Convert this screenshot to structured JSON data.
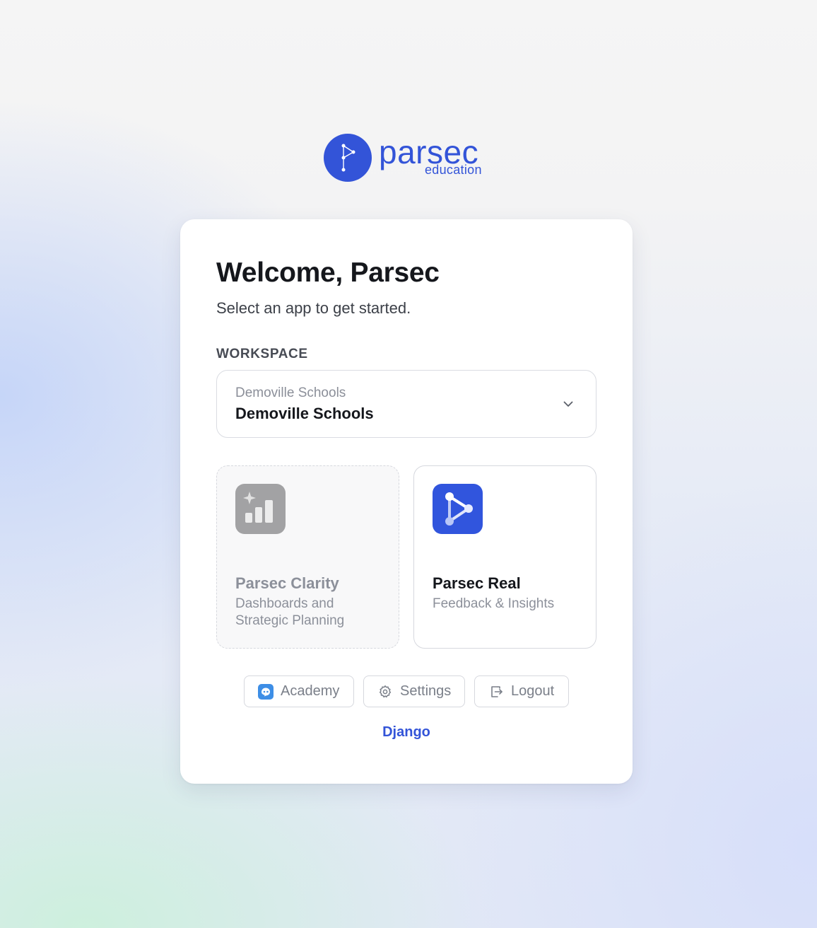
{
  "brand": {
    "name": "parsec",
    "tagline": "education",
    "color": "#3354d8"
  },
  "welcome": {
    "title": "Welcome, Parsec",
    "subtitle": "Select an app to get started."
  },
  "workspace": {
    "label": "WORKSPACE",
    "placeholder": "Demoville Schools",
    "selected": "Demoville Schools",
    "icon": "chevron-down-icon"
  },
  "apps": [
    {
      "name": "Parsec Clarity",
      "description": "Dashboards and Strategic Planning",
      "icon": "bar-chart-sparkle-icon",
      "state": "disabled",
      "color": "#a2a2a4"
    },
    {
      "name": "Parsec Real",
      "description": "Feedback & Insights",
      "icon": "parsec-real-icon",
      "state": "enabled",
      "color": "#3155dd"
    }
  ],
  "actions": [
    {
      "label": "Academy",
      "icon": "academy-icon"
    },
    {
      "label": "Settings",
      "icon": "gear-icon"
    },
    {
      "label": "Logout",
      "icon": "logout-icon"
    }
  ],
  "footer": {
    "link": "Django"
  }
}
